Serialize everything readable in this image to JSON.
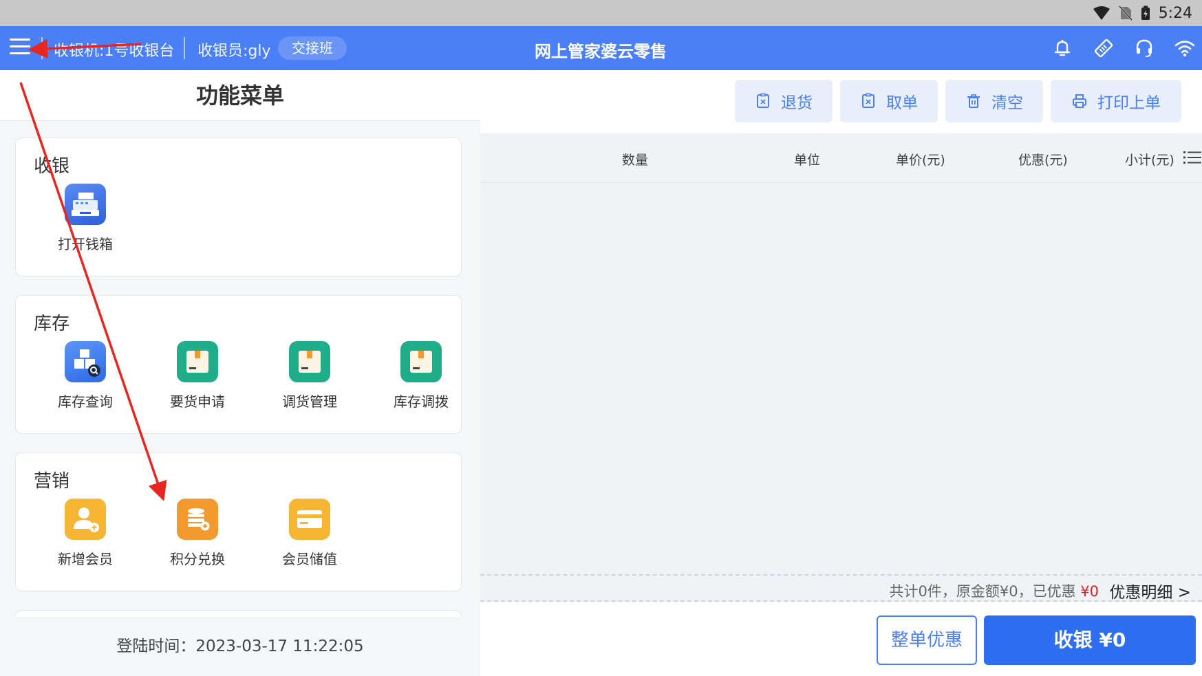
{
  "status_bar": {
    "time": "5:24",
    "icons": [
      "wifi-signal-icon",
      "no-sim-icon",
      "battery-icon"
    ]
  },
  "app_bar": {
    "menu_icon": "hamburger-menu-icon",
    "register": "收银机:1号收银台",
    "cashier": "收银员:gly",
    "shift_button": "交接班",
    "title": "网上管家婆云零售",
    "icons": [
      "bell-icon",
      "tag-icon",
      "headset-icon",
      "wifi-icon"
    ],
    "color": "#4b7ff5"
  },
  "left_panel": {
    "title": "功能菜单",
    "sections": [
      {
        "title": "收银",
        "items": [
          {
            "label": "打开钱箱",
            "icon": "cash-register-icon",
            "color": "#3f6fe8"
          }
        ]
      },
      {
        "title": "库存",
        "items": [
          {
            "label": "库存查询",
            "icon": "stock-search-icon",
            "color": "#3d79ee"
          },
          {
            "label": "要货申请",
            "icon": "box-request-icon",
            "color": "#20b08a"
          },
          {
            "label": "调货管理",
            "icon": "box-transfer-icon",
            "color": "#20b08a"
          },
          {
            "label": "库存调拨",
            "icon": "box-allocate-icon",
            "color": "#20b08a"
          }
        ]
      },
      {
        "title": "营销",
        "items": [
          {
            "label": "新增会员",
            "icon": "add-member-icon",
            "color": "#f5b534"
          },
          {
            "label": "积分兑换",
            "icon": "points-exchange-icon",
            "color": "#f39a2e"
          },
          {
            "label": "会员储值",
            "icon": "member-card-icon",
            "color": "#f5b534"
          }
        ]
      }
    ],
    "login_time": "登陆时间：2023-03-17 11:22:05"
  },
  "toolbar": {
    "buttons": [
      {
        "label": "退货",
        "icon": "return-icon"
      },
      {
        "label": "取单",
        "icon": "retrieve-order-icon"
      },
      {
        "label": "清空",
        "icon": "trash-icon"
      },
      {
        "label": "打印上单",
        "icon": "printer-icon"
      }
    ]
  },
  "table": {
    "columns": [
      "数量",
      "单位",
      "单价(元)",
      "优惠(元)",
      "小计(元)"
    ],
    "columns_icon": "column-list-icon"
  },
  "summary": {
    "text": "共计0件，原金额¥0，已优惠",
    "discount_amount": "¥0",
    "detail_link": "优惠明细 >"
  },
  "actions": {
    "discount_button": "整单优惠",
    "pay_button": "收银 ¥0"
  },
  "annotation": {
    "arrow_color": "#e8251f"
  }
}
